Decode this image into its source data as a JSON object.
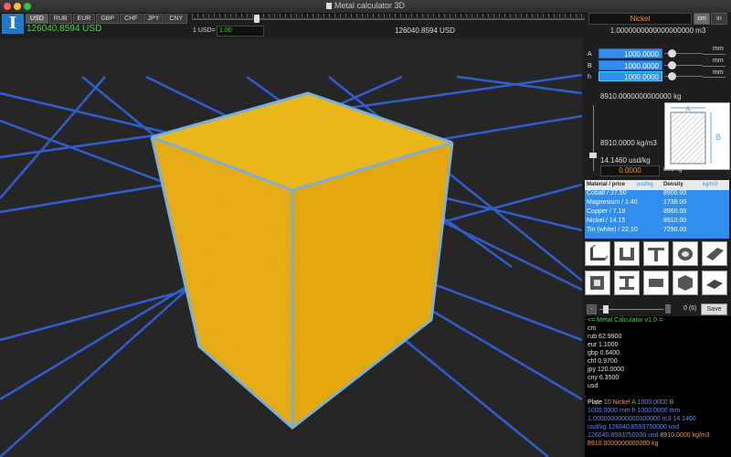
{
  "window": {
    "title": "Metal calculator 3D"
  },
  "currency": {
    "tabs": [
      "USD",
      "RUB",
      "EUR",
      "GBP",
      "CHF",
      "JPY",
      "CNY"
    ],
    "selected": "USD",
    "total": "126040.8594 USD",
    "rate_label": "1 USD=",
    "rate_value": "1.00",
    "center_total": "126040.8594 USD"
  },
  "material": {
    "name": "Nickel"
  },
  "units": {
    "cm": "cm",
    "in": "in",
    "selected": "cm"
  },
  "volume": "1.0000000000000000000 m3",
  "dimensions": [
    {
      "label": "A",
      "value": "1000.0000",
      "unit": "mm"
    },
    {
      "label": "B",
      "value": "1000.0000",
      "unit": "mm"
    },
    {
      "label": "h",
      "value": "1000.0000",
      "unit": "mm"
    }
  ],
  "weight": "8910.0000000000000 kg",
  "density": "8910.0000 kg/m3",
  "price_per_kg": "14.1460 usd/kg",
  "price_input": "0.0000",
  "price_unit": "usd/kg",
  "section": {
    "label_a": "A",
    "label_b": "B"
  },
  "table": {
    "col_material": "Material / price",
    "col_price_unit": "usd/kg",
    "col_density": "Density",
    "col_density_unit": "kg/m3",
    "rows": [
      {
        "name": "Cobalt / 27.50",
        "density": "8900.00"
      },
      {
        "name": "Magnesium / 1.40",
        "density": "1738.00"
      },
      {
        "name": "Copper / 7.18",
        "density": "8960.00"
      },
      {
        "name": "Nickel / 14.15",
        "density": "8910.00"
      },
      {
        "name": "Tin (white) / 22.10",
        "density": "7290.00"
      }
    ]
  },
  "profiles": [
    "angle",
    "channel",
    "tee",
    "pipe",
    "sheet",
    "square-tube",
    "beam",
    "bar",
    "hexagon",
    "plate"
  ],
  "counter": {
    "minus": "-",
    "count": "0 (6)",
    "save": "Save"
  },
  "log": {
    "header": "<= Metal Calculator v1.0 =",
    "lines": [
      "cm",
      "rub 62.9900",
      "eur 1.1000",
      "gbp 0.6400",
      "chf 0.9700",
      "jpy 120.0000",
      "cny 6.3500",
      "usd"
    ],
    "plate_line": {
      "type": "Plate",
      "num": "10",
      "metal": "Nickel",
      "a_label": "A",
      "a_value": "1000.0000",
      "b_label": "B"
    },
    "line2": {
      "a": "1000.0000",
      "unit_mm": "mm",
      "h": "h 1000.0000",
      "unit_mm2": "mm"
    },
    "line3": {
      "vol": "1.0000000000000000000",
      "unit": "m3",
      "price": "14.1460"
    },
    "line4": {
      "unit": "usd/kg",
      "value": "126040.8593750000",
      "unit2": "usd"
    },
    "line5": {
      "value": "126040.8593750000",
      "unit": "usd",
      "density": "8910.0000",
      "unit2": "kg/m3"
    },
    "line6": {
      "weight": "8910.0000000000000",
      "unit": "kg"
    }
  },
  "colors": {
    "accent": "#2f8ef0",
    "cube": "#f5b81d",
    "edge": "#7ab0d8",
    "grid": "#2e5fd0",
    "orange": "#f29a2e",
    "green": "#3cdc3c"
  }
}
